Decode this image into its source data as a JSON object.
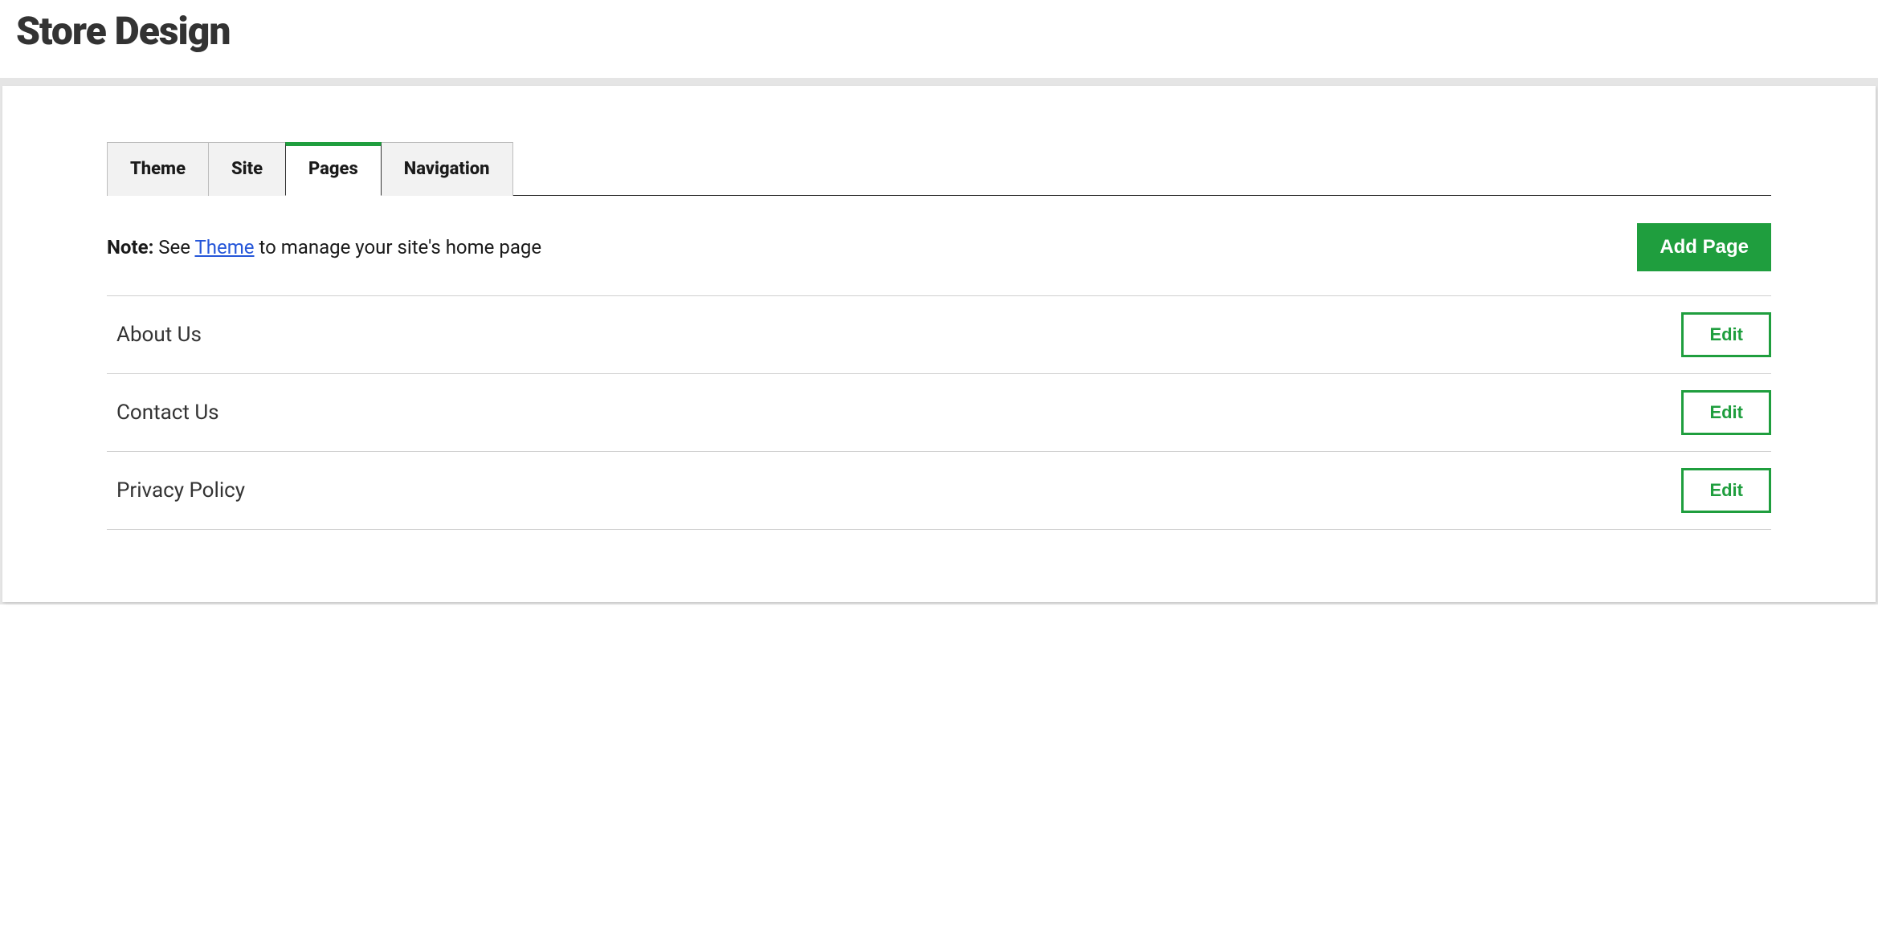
{
  "header": {
    "title": "Store Design"
  },
  "tabs": [
    {
      "label": "Theme",
      "active": false
    },
    {
      "label": "Site",
      "active": false
    },
    {
      "label": "Pages",
      "active": true
    },
    {
      "label": "Navigation",
      "active": false
    }
  ],
  "note": {
    "label": "Note:",
    "prefix": " See ",
    "link": "Theme",
    "suffix": " to manage your site's home page"
  },
  "buttons": {
    "add_page": "Add Page",
    "edit": "Edit"
  },
  "pages": [
    {
      "name": "About Us"
    },
    {
      "name": "Contact Us"
    },
    {
      "name": "Privacy Policy"
    }
  ],
  "colors": {
    "accent": "#1f9e3e",
    "link": "#2556d9"
  }
}
